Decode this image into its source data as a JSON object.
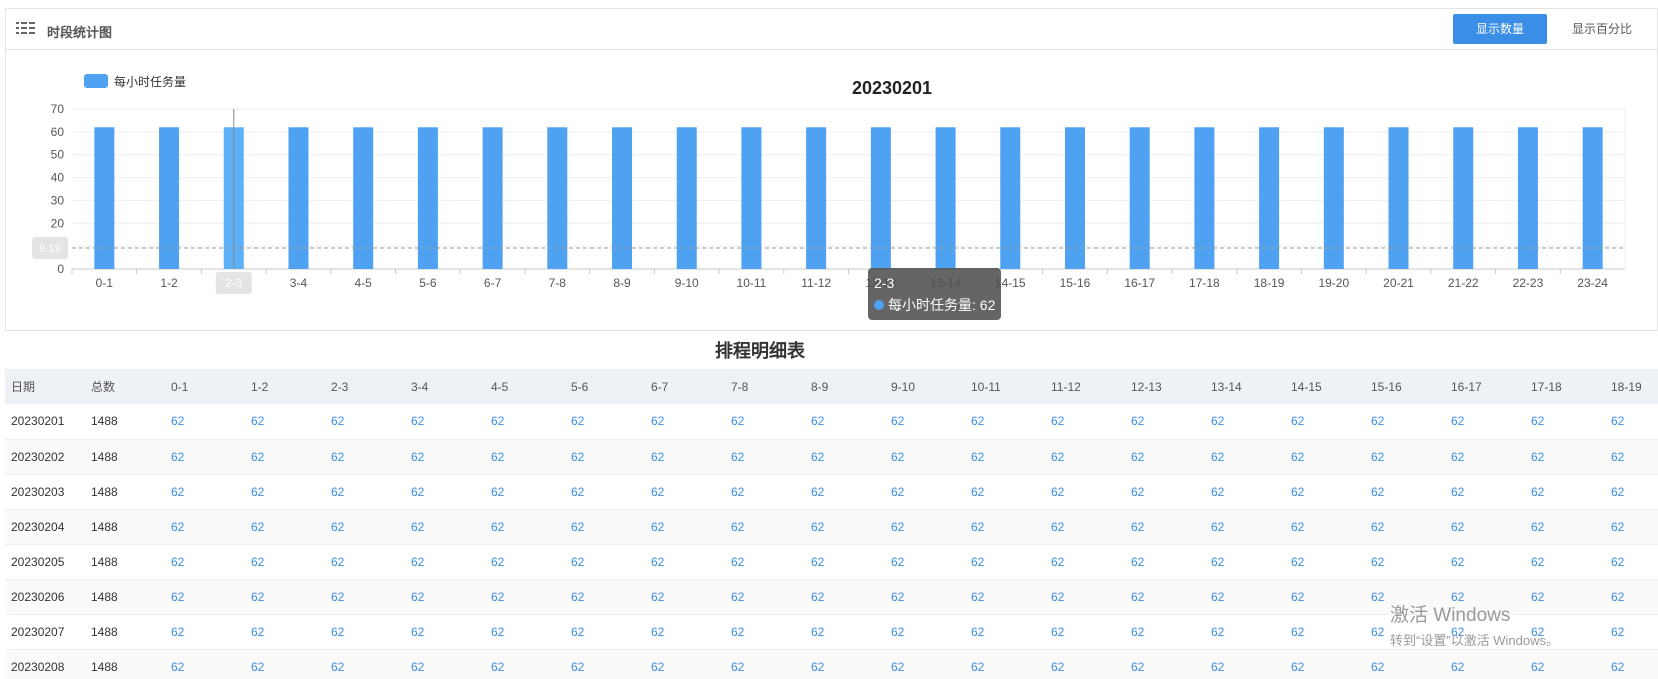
{
  "header": {
    "title": "时段统计图",
    "btn_count": "显示数量",
    "btn_pct": "显示百分比"
  },
  "chart_data": {
    "type": "bar",
    "title": "20230201",
    "legend": "每小时任务量",
    "legend_position": "top-left",
    "categories": [
      "0-1",
      "1-2",
      "2-3",
      "3-4",
      "4-5",
      "5-6",
      "6-7",
      "7-8",
      "8-9",
      "9-10",
      "10-11",
      "11-12",
      "12-13",
      "13-14",
      "14-15",
      "15-16",
      "16-17",
      "17-18",
      "18-19",
      "19-20",
      "20-21",
      "21-22",
      "22-23",
      "23-24"
    ],
    "series": [
      {
        "name": "每小时任务量",
        "values": [
          62,
          62,
          62,
          62,
          62,
          62,
          62,
          62,
          62,
          62,
          62,
          62,
          62,
          62,
          62,
          62,
          62,
          62,
          62,
          62,
          62,
          62,
          62,
          62
        ],
        "color": "#4fa1f2"
      }
    ],
    "ylim": [
      0,
      70
    ],
    "yticks": [
      0,
      10,
      20,
      30,
      40,
      50,
      60,
      70
    ],
    "grid": true,
    "hover_category": "2-3",
    "pointer_y_label": "9.19",
    "pointer_y_value": 9.19,
    "tooltip": {
      "title": "2-3",
      "label": "每小时任务量: 62"
    }
  },
  "table": {
    "title": "排程明细表",
    "columns": [
      "日期",
      "总数",
      "0-1",
      "1-2",
      "2-3",
      "3-4",
      "4-5",
      "5-6",
      "6-7",
      "7-8",
      "8-9",
      "9-10",
      "10-11",
      "11-12",
      "12-13",
      "13-14",
      "14-15",
      "15-16",
      "16-17",
      "17-18",
      "18-19"
    ],
    "rows": [
      [
        "20230201",
        "1488",
        "62",
        "62",
        "62",
        "62",
        "62",
        "62",
        "62",
        "62",
        "62",
        "62",
        "62",
        "62",
        "62",
        "62",
        "62",
        "62",
        "62",
        "62",
        "62"
      ],
      [
        "20230202",
        "1488",
        "62",
        "62",
        "62",
        "62",
        "62",
        "62",
        "62",
        "62",
        "62",
        "62",
        "62",
        "62",
        "62",
        "62",
        "62",
        "62",
        "62",
        "62",
        "62"
      ],
      [
        "20230203",
        "1488",
        "62",
        "62",
        "62",
        "62",
        "62",
        "62",
        "62",
        "62",
        "62",
        "62",
        "62",
        "62",
        "62",
        "62",
        "62",
        "62",
        "62",
        "62",
        "62"
      ],
      [
        "20230204",
        "1488",
        "62",
        "62",
        "62",
        "62",
        "62",
        "62",
        "62",
        "62",
        "62",
        "62",
        "62",
        "62",
        "62",
        "62",
        "62",
        "62",
        "62",
        "62",
        "62"
      ],
      [
        "20230205",
        "1488",
        "62",
        "62",
        "62",
        "62",
        "62",
        "62",
        "62",
        "62",
        "62",
        "62",
        "62",
        "62",
        "62",
        "62",
        "62",
        "62",
        "62",
        "62",
        "62"
      ],
      [
        "20230206",
        "1488",
        "62",
        "62",
        "62",
        "62",
        "62",
        "62",
        "62",
        "62",
        "62",
        "62",
        "62",
        "62",
        "62",
        "62",
        "62",
        "62",
        "62",
        "62",
        "62"
      ],
      [
        "20230207",
        "1488",
        "62",
        "62",
        "62",
        "62",
        "62",
        "62",
        "62",
        "62",
        "62",
        "62",
        "62",
        "62",
        "62",
        "62",
        "62",
        "62",
        "62",
        "62",
        "62"
      ],
      [
        "20230208",
        "1488",
        "62",
        "62",
        "62",
        "62",
        "62",
        "62",
        "62",
        "62",
        "62",
        "62",
        "62",
        "62",
        "62",
        "62",
        "62",
        "62",
        "62",
        "62",
        "62"
      ]
    ]
  },
  "watermark": {
    "line1": "激活 Windows",
    "line2": "转到“设置”以激活 Windows。"
  }
}
